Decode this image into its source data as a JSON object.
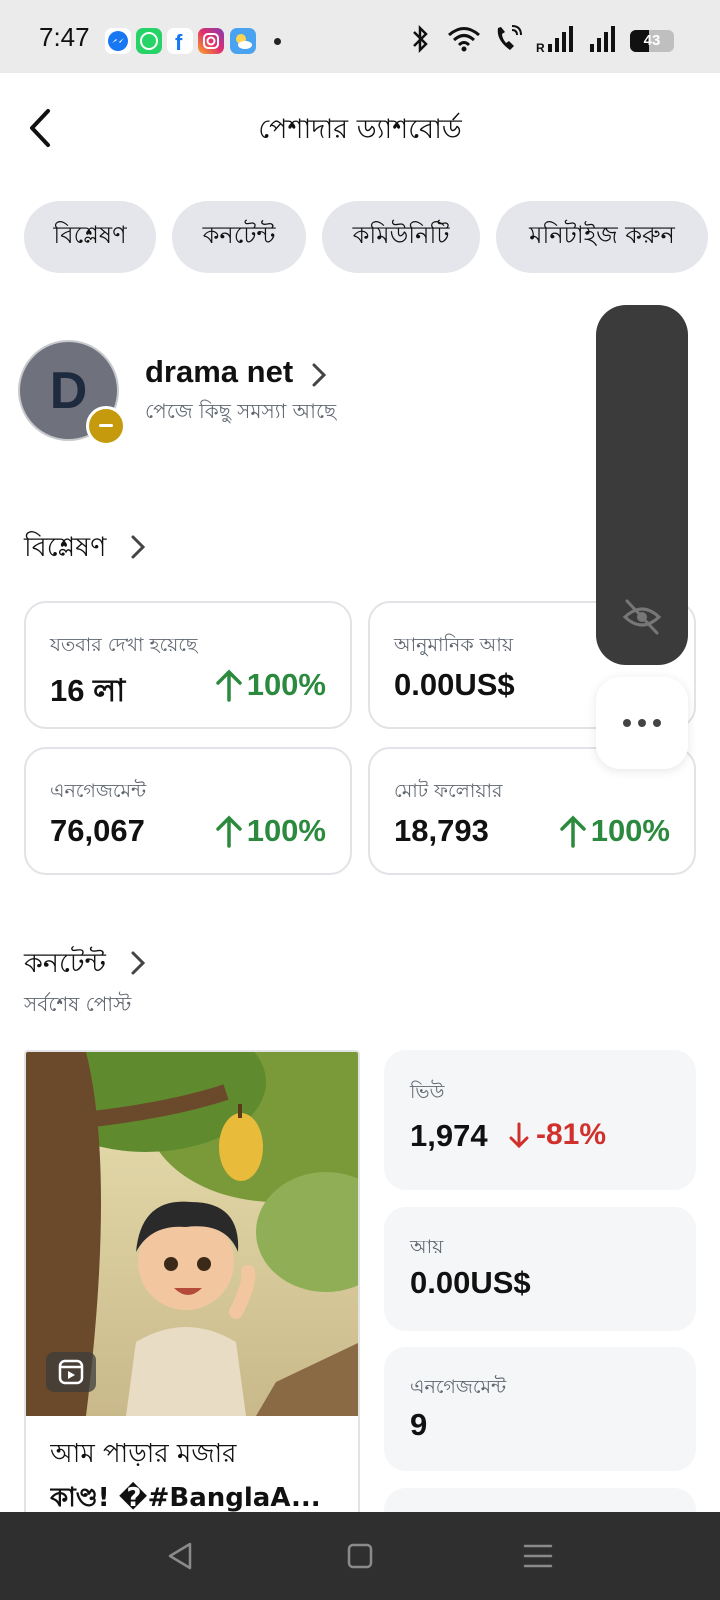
{
  "status_bar": {
    "time": "7:47",
    "battery": "43",
    "apps": [
      "messenger-icon",
      "whatsapp-icon",
      "facebook-icon",
      "instagram-icon",
      "weather-icon"
    ]
  },
  "header": {
    "title": "পেশাদার ড্যাশবোর্ড"
  },
  "tabs": [
    {
      "label": "বিশ্লেষণ"
    },
    {
      "label": "কনটেন্ট"
    },
    {
      "label": "কমিউনিটি"
    },
    {
      "label": "মনিটাইজ করুন"
    }
  ],
  "profile": {
    "initial": "D",
    "name": "drama net",
    "status": "পেজে কিছু সমস্যা আছে"
  },
  "analytics": {
    "title": "বিশ্লেষণ",
    "cards": [
      {
        "label": "যতবার দেখা হয়েছে",
        "value": "16 লা",
        "delta": "100%"
      },
      {
        "label": "আনুমানিক আয়",
        "value": "0.00US$",
        "delta": ""
      },
      {
        "label": "এনগেজমেন্ট",
        "value": "76,067",
        "delta": "100%"
      },
      {
        "label": "মোট ফলোয়ার",
        "value": "18,793",
        "delta": "100%"
      }
    ]
  },
  "content": {
    "title": "কনটেন্ট",
    "subtitle": "সর্বশেষ পোস্ট",
    "post": {
      "caption_line1": "আম পাড়ার মজার",
      "caption_line2": "কাণ্ড! �#BanglaA..."
    },
    "metrics": [
      {
        "label": "ভিউ",
        "value": "1,974",
        "delta": "-81%"
      },
      {
        "label": "আয়",
        "value": "0.00US$"
      },
      {
        "label": "এনগেজমেন্ট",
        "value": "9"
      }
    ]
  },
  "colors": {
    "positive": "#2b8a3e",
    "negative": "#d0312d",
    "tab_bg": "#e4e6eb",
    "badge": "#c59a0c"
  }
}
